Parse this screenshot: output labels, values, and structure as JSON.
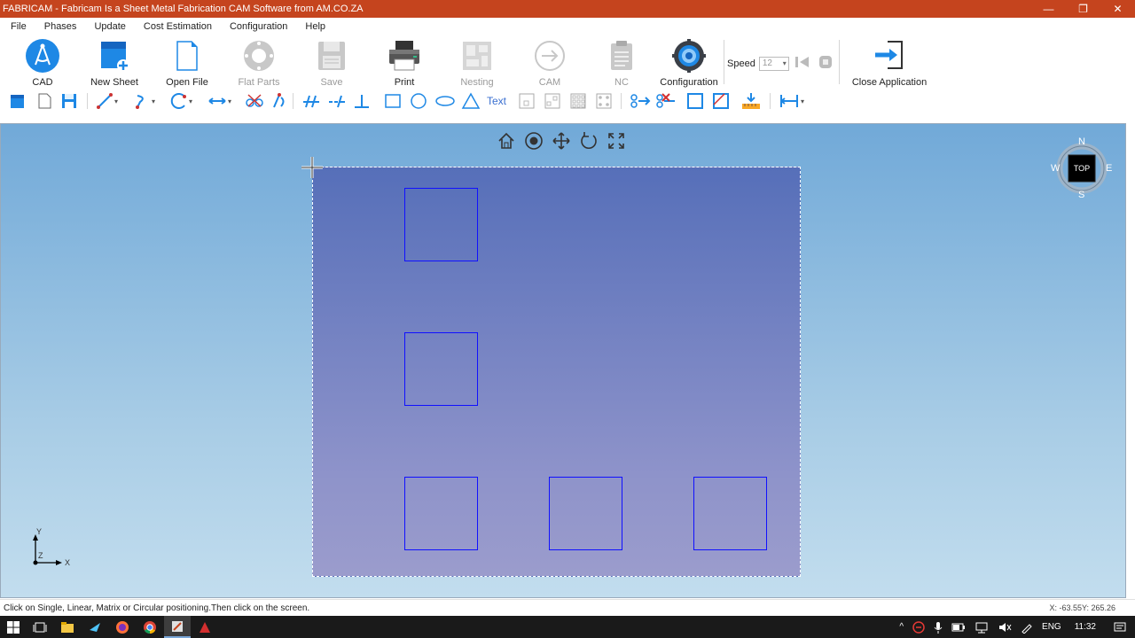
{
  "window": {
    "title": "FABRICAM - Fabricam Is a Sheet Metal Fabrication CAM Software from AM.CO.ZA"
  },
  "menu": [
    "File",
    "Phases",
    "Update",
    "Cost Estimation",
    "Configuration",
    "Help"
  ],
  "ribbon": {
    "cad": "CAD",
    "new_sheet": "New Sheet",
    "open_file": "Open File",
    "flat_parts": "Flat Parts",
    "save": "Save",
    "print": "Print",
    "nesting": "Nesting",
    "cam": "CAM",
    "nc": "NC",
    "configuration": "Configuration",
    "speed_label": "Speed",
    "speed_value": "12",
    "close_application": "Close Application"
  },
  "toolbar": {
    "text_label": "Text"
  },
  "compass": {
    "north": "N",
    "south": "S",
    "east": "E",
    "west": "W",
    "view": "TOP"
  },
  "axes": {
    "x": "X",
    "y": "Y",
    "z": "Z"
  },
  "status": {
    "message": "Click on Single, Linear, Matrix or Circular positioning.Then click on the screen.",
    "coords": "X: -63.55Y: 265.26"
  },
  "taskbar": {
    "language": "ENG",
    "time": "11:32"
  },
  "colors": {
    "titlebar": "#c5441e",
    "part_outline": "#1010ff",
    "sheet_top": "#566fb9",
    "accent": "#1e88e5"
  }
}
